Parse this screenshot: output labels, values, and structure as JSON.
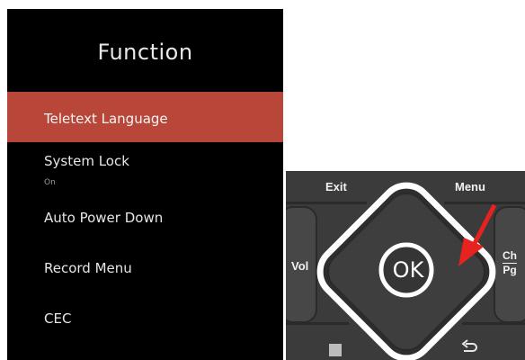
{
  "menu": {
    "title": "Function",
    "items": [
      {
        "label": "Teletext Language",
        "value": "",
        "selected": true
      },
      {
        "label": "System Lock",
        "value": "On",
        "selected": false
      },
      {
        "label": "Auto Power Down",
        "value": "",
        "selected": false
      },
      {
        "label": "Record Menu",
        "value": "",
        "selected": false
      },
      {
        "label": "CEC",
        "value": "",
        "selected": false
      }
    ]
  },
  "remote": {
    "exit_label": "Exit",
    "menu_label": "Menu",
    "vol_label": "Vol",
    "ok_label": "OK",
    "ch_label": "Ch",
    "pg_label": "Pg",
    "mute_icon": "mute-icon",
    "back_icon": "back-arrow-icon",
    "pointer_icon": "red-arrow-icon"
  },
  "colors": {
    "menu_bg": "#000000",
    "selected_bg": "#b8473a",
    "remote_body": "#3b3b3b",
    "arrow": "#e8231f"
  }
}
